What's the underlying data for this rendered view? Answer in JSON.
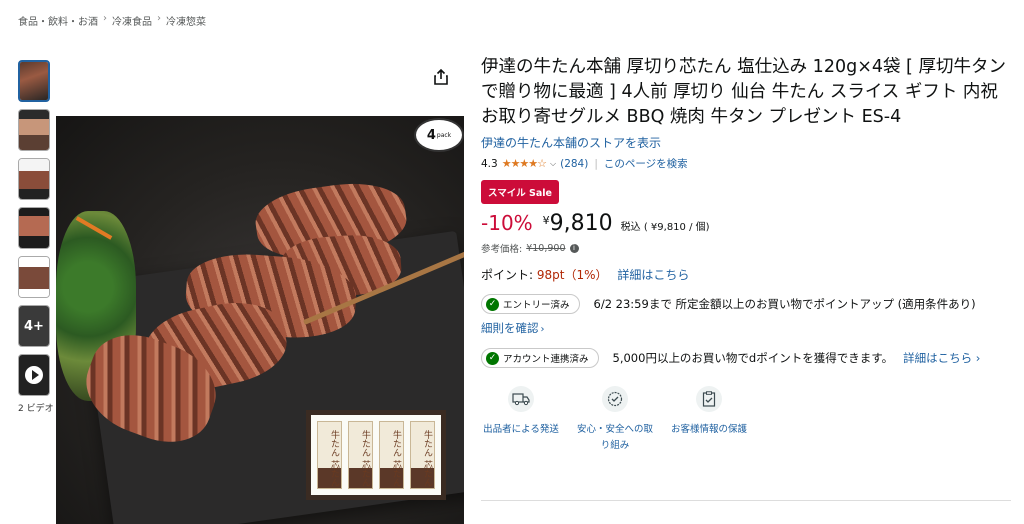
{
  "breadcrumb": [
    "食品・飲料・お酒",
    "冷凍食品",
    "冷凍惣菜"
  ],
  "gallery": {
    "thumb_more_label": "4+",
    "video_label": "2 ビデオ",
    "pack_label": "4",
    "pack_sub": "pack",
    "box_pack_label": "牛たん 芯たん"
  },
  "product": {
    "title": "伊達の牛たん本舗 厚切り芯たん 塩仕込み 120g×4袋 [ 厚切牛タンで贈り物に最適 ] 4人前 厚切り 仙台 牛たん スライス ギフト 内祝 お取り寄せグルメ BBQ 焼肉 牛タン プレゼント ES-4",
    "store_link": "伊達の牛たん本舗のストアを表示",
    "rating": "4.3",
    "stars": "★★★★☆",
    "review_count": "(284)",
    "page_search": "このページを検索",
    "sale_badge": "スマイル Sale",
    "discount": "-10%",
    "currency": "¥",
    "price": "9,810",
    "price_note": "税込 ( ¥9,810 / 個)",
    "ref_label": "参考価格:",
    "ref_price": "¥10,900",
    "points_label": "ポイント:",
    "points_value": "98pt（1%）",
    "points_link": "詳細はこちら"
  },
  "promos": [
    {
      "pill": "エントリー済み",
      "text": "6/2 23:59まで 所定金額以上のお買い物でポイントアップ (適用条件あり)"
    },
    {
      "pill": "アカウント連携済み",
      "text": "5,000円以上のお買い物でdポイントを獲得できます。"
    }
  ],
  "rules_link": "細則を確認",
  "promo2_link": "詳細はこちら",
  "features": [
    {
      "label": "出品者による発送",
      "icon": "truck-icon"
    },
    {
      "label": "安心・安全への取り組み",
      "icon": "shield-check-icon"
    },
    {
      "label": "お客様情報の保護",
      "icon": "clipboard-check-icon"
    }
  ],
  "colors": {
    "link": "#2162a1",
    "sale": "#cc0c39",
    "stars": "#de7921",
    "check": "#007600"
  }
}
